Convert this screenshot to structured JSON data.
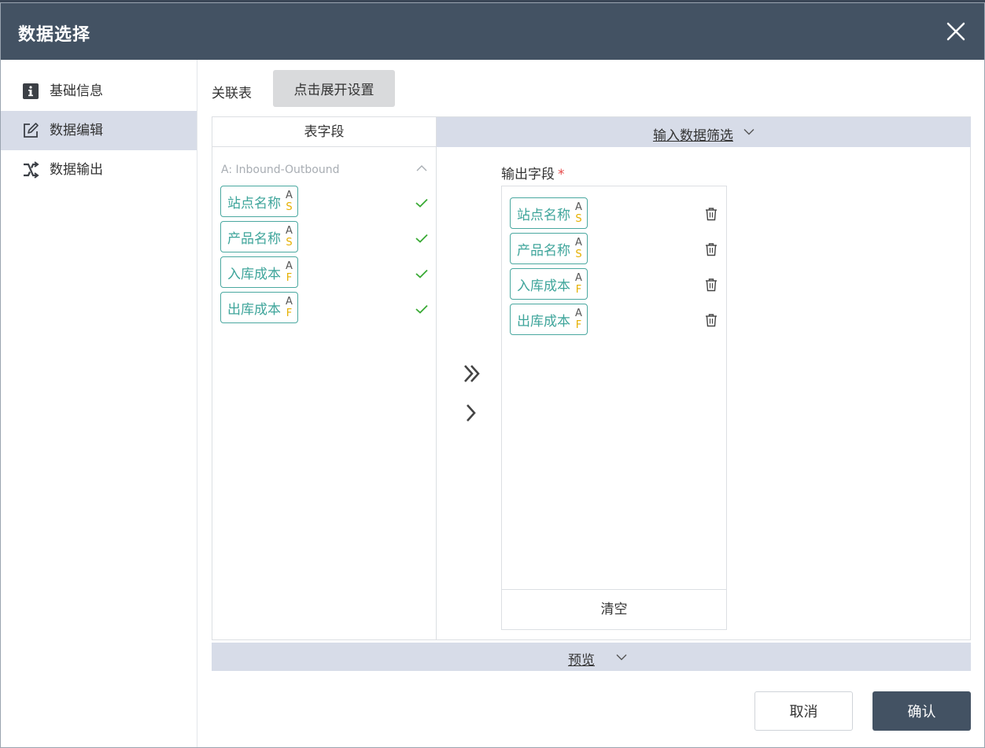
{
  "dialog": {
    "title": "数据选择",
    "close_icon": "close-icon"
  },
  "sidebar": {
    "items": [
      {
        "label": "基础信息",
        "icon": "info-icon",
        "active": false
      },
      {
        "label": "数据编辑",
        "icon": "edit-icon",
        "active": true
      },
      {
        "label": "数据输出",
        "icon": "shuffle-icon",
        "active": false
      }
    ]
  },
  "main": {
    "relation_label": "关联表",
    "expand_button": "点击展开设置",
    "fields_header": "表字段",
    "filter_label": "输入数据筛选",
    "group_title": "A: Inbound-Outbound",
    "source_fields": [
      {
        "name": "站点名称",
        "badge": "A",
        "type": "S",
        "checked": true
      },
      {
        "name": "产品名称",
        "badge": "A",
        "type": "S",
        "checked": true
      },
      {
        "name": "入库成本",
        "badge": "A",
        "type": "F",
        "checked": true
      },
      {
        "name": "出库成本",
        "badge": "A",
        "type": "F",
        "checked": true
      }
    ],
    "output_label": "输出字段",
    "required_mark": "*",
    "output_fields": [
      {
        "name": "站点名称",
        "badge": "A",
        "type": "S"
      },
      {
        "name": "产品名称",
        "badge": "A",
        "type": "S"
      },
      {
        "name": "入库成本",
        "badge": "A",
        "type": "F"
      },
      {
        "name": "出库成本",
        "badge": "A",
        "type": "F"
      }
    ],
    "clear_label": "清空",
    "preview_label": "预览"
  },
  "footer": {
    "cancel_label": "取消",
    "confirm_label": "确认"
  },
  "colors": {
    "header_bg": "#435263",
    "active_nav_bg": "#d7dce8",
    "chip_border": "#4aa8a0",
    "chip_text": "#3fa59b",
    "type_badge": "#e6b000",
    "check_green": "#3aaa35",
    "required_red": "#e54848"
  }
}
